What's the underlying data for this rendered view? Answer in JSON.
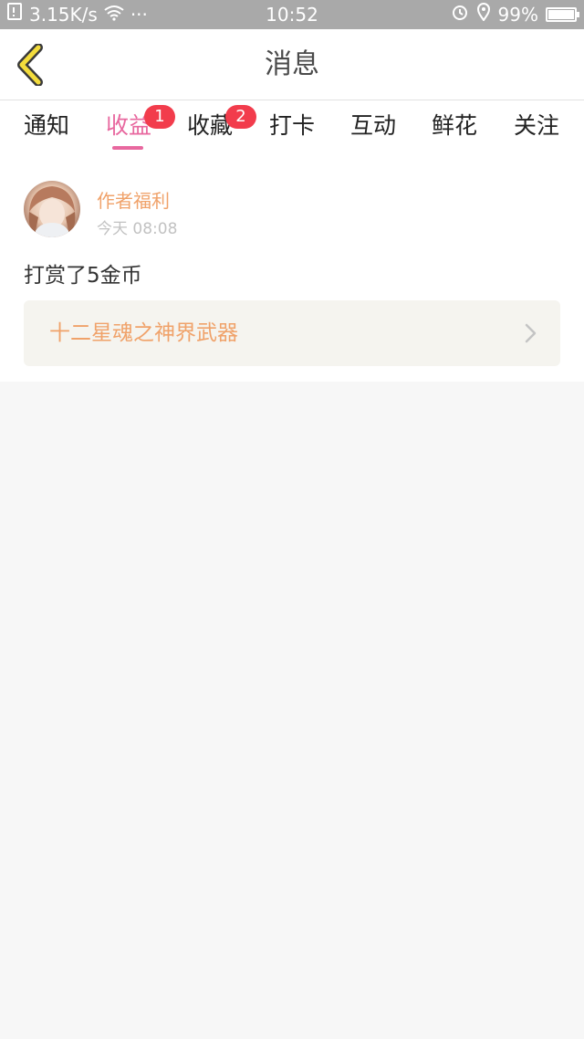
{
  "status_bar": {
    "net_speed": "3.15K/s",
    "more": "···",
    "time": "10:52",
    "battery_percent_text": "99%",
    "battery_level": 0.99
  },
  "header": {
    "title": "消息"
  },
  "tabs": [
    {
      "label": "通知",
      "badge": ""
    },
    {
      "label": "收益",
      "badge": "1",
      "active": true
    },
    {
      "label": "收藏",
      "badge": "2"
    },
    {
      "label": "打卡",
      "badge": ""
    },
    {
      "label": "互动",
      "badge": ""
    },
    {
      "label": "鲜花",
      "badge": ""
    },
    {
      "label": "关注",
      "badge": ""
    }
  ],
  "message": {
    "sender": "作者福利",
    "time": "今天 08:08",
    "text": "打赏了5金币",
    "book_title": "十二星魂之神界武器"
  },
  "colors": {
    "accent_pink": "#e8689f",
    "badge_red": "#f23c4c",
    "orange_text": "#f0a26a",
    "back_arrow_yellow": "#f3dc3c"
  }
}
